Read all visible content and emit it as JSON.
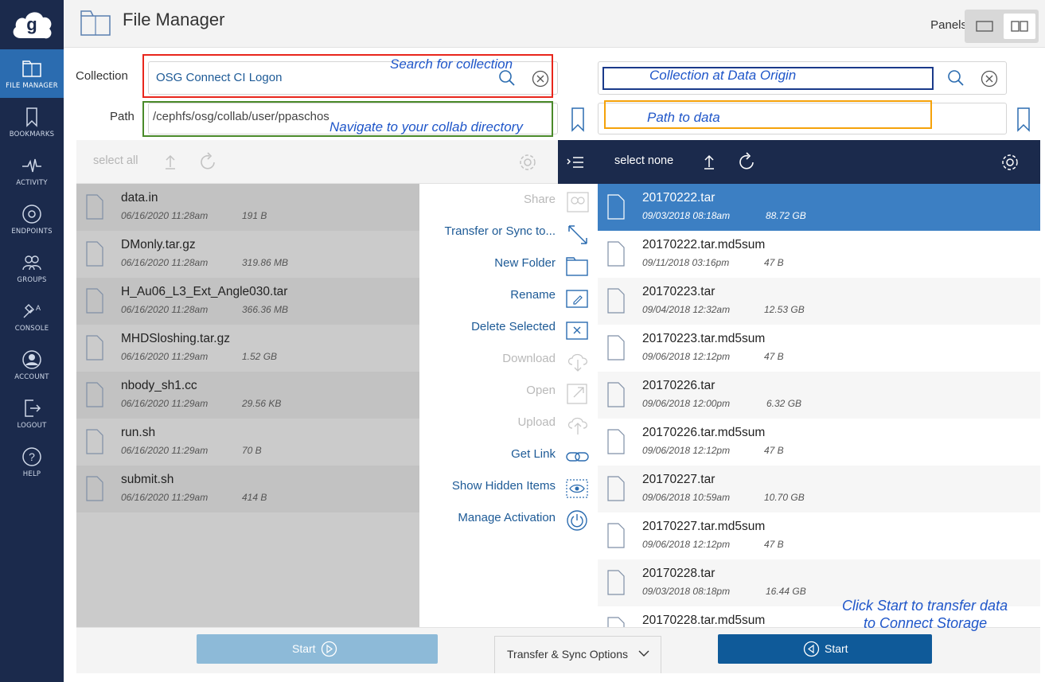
{
  "sidebar": {
    "logo": "globus-logo",
    "items": [
      {
        "label": "FILE MANAGER",
        "icon": "folders-icon",
        "active": true
      },
      {
        "label": "BOOKMARKS",
        "icon": "bookmark-icon"
      },
      {
        "label": "ACTIVITY",
        "icon": "pulse-icon"
      },
      {
        "label": "ENDPOINTS",
        "icon": "endpoint-icon"
      },
      {
        "label": "GROUPS",
        "icon": "groups-icon"
      },
      {
        "label": "CONSOLE",
        "icon": "console-icon"
      },
      {
        "label": "ACCOUNT",
        "icon": "account-icon"
      },
      {
        "label": "LOGOUT",
        "icon": "logout-icon"
      },
      {
        "label": "HELP",
        "icon": "help-icon"
      }
    ]
  },
  "header": {
    "title": "File Manager",
    "panels_label": "Panels"
  },
  "left_panel": {
    "collection_label": "Collection",
    "collection_value": "OSG Connect CI Logon",
    "path_label": "Path",
    "path_value": "/cephfs/osg/collab/user/ppaschos",
    "toolbar": {
      "select_label": "select all"
    },
    "files": [
      {
        "name": "data.in",
        "date": "06/16/2020 11:28am",
        "size": "191 B"
      },
      {
        "name": "DMonly.tar.gz",
        "date": "06/16/2020 11:28am",
        "size": "319.86 MB"
      },
      {
        "name": "H_Au06_L3_Ext_Angle030.tar",
        "date": "06/16/2020 11:28am",
        "size": "366.36 MB"
      },
      {
        "name": "MHDSloshing.tar.gz",
        "date": "06/16/2020 11:29am",
        "size": "1.52 GB"
      },
      {
        "name": "nbody_sh1.cc",
        "date": "06/16/2020 11:29am",
        "size": "29.56 KB"
      },
      {
        "name": "run.sh",
        "date": "06/16/2020 11:29am",
        "size": "70 B"
      },
      {
        "name": "submit.sh",
        "date": "06/16/2020 11:29am",
        "size": "414 B"
      }
    ]
  },
  "right_panel": {
    "toolbar": {
      "select_label": "select none"
    },
    "files": [
      {
        "name": "20170222.tar",
        "date": "09/03/2018 08:18am",
        "size": "88.72 GB",
        "selected": true
      },
      {
        "name": "20170222.tar.md5sum",
        "date": "09/11/2018 03:16pm",
        "size": "47 B"
      },
      {
        "name": "20170223.tar",
        "date": "09/04/2018 12:32am",
        "size": "12.53 GB"
      },
      {
        "name": "20170223.tar.md5sum",
        "date": "09/06/2018 12:12pm",
        "size": "47 B"
      },
      {
        "name": "20170226.tar",
        "date": "09/06/2018 12:00pm",
        "size": "6.32 GB"
      },
      {
        "name": "20170226.tar.md5sum",
        "date": "09/06/2018 12:12pm",
        "size": "47 B"
      },
      {
        "name": "20170227.tar",
        "date": "09/06/2018 10:59am",
        "size": "10.70 GB"
      },
      {
        "name": "20170227.tar.md5sum",
        "date": "09/06/2018 12:12pm",
        "size": "47 B"
      },
      {
        "name": "20170228.tar",
        "date": "09/03/2018 08:18pm",
        "size": "16.44 GB"
      },
      {
        "name": "20170228.tar.md5sum",
        "date": "",
        "size": ""
      }
    ]
  },
  "actions": [
    {
      "label": "Share",
      "enabled": false,
      "icon": "share-icon"
    },
    {
      "label": "Transfer or Sync to...",
      "enabled": true,
      "icon": "transfer-icon"
    },
    {
      "label": "New Folder",
      "enabled": true,
      "icon": "new-folder-icon"
    },
    {
      "label": "Rename",
      "enabled": true,
      "icon": "rename-icon"
    },
    {
      "label": "Delete Selected",
      "enabled": true,
      "icon": "delete-icon"
    },
    {
      "label": "Download",
      "enabled": false,
      "icon": "download-icon"
    },
    {
      "label": "Open",
      "enabled": false,
      "icon": "open-icon"
    },
    {
      "label": "Upload",
      "enabled": false,
      "icon": "upload-icon"
    },
    {
      "label": "Get Link",
      "enabled": true,
      "icon": "link-icon"
    },
    {
      "label": "Show Hidden Items",
      "enabled": true,
      "icon": "eye-icon"
    },
    {
      "label": "Manage Activation",
      "enabled": true,
      "icon": "power-icon"
    }
  ],
  "footer": {
    "start_left": "Start",
    "start_right": "Start",
    "sync_options": "Transfer & Sync Options"
  },
  "annotations": {
    "search_collection": "Search for collection",
    "navigate_collab": "Navigate to your collab directory",
    "collection_origin": "Collection at Data Origin",
    "path_to_data": "Path to data",
    "click_start_1": "Click Start to transfer data",
    "click_start_2": "to Connect Storage"
  },
  "colors": {
    "sidebar_bg": "#1b2a4c",
    "active_nav": "#2b6cb0",
    "link_blue": "#1d5a96",
    "selected_row": "#3c7fc3",
    "annotation_red": "#e8261c",
    "annotation_green": "#4a8a2a",
    "annotation_navy": "#1a3a8a",
    "annotation_orange": "#f5a20a"
  }
}
